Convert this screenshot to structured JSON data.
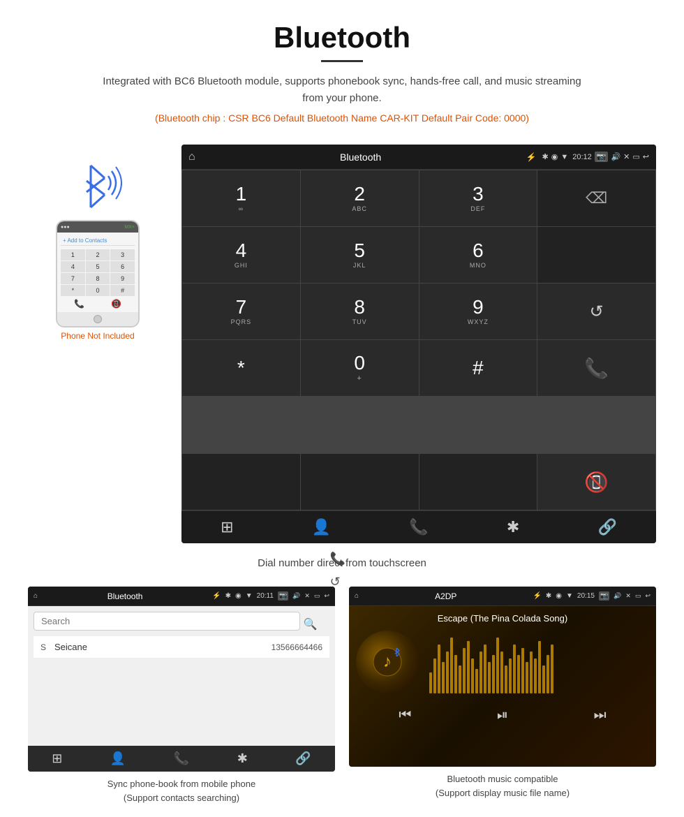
{
  "header": {
    "title": "Bluetooth",
    "underline": true,
    "description": "Integrated with BC6 Bluetooth module, supports phonebook sync, hands-free call, and music streaming from your phone.",
    "specs": "(Bluetooth chip : CSR BC6    Default Bluetooth Name CAR-KIT    Default Pair Code: 0000)"
  },
  "main_screen": {
    "status_bar": {
      "home_icon": "⌂",
      "app_title": "Bluetooth",
      "usb_icon": "⚡",
      "bt_icon": "✱",
      "location_icon": "◉",
      "signal_icon": "▼",
      "time": "20:12",
      "camera_icon": "📷",
      "volume_icon": "🔊",
      "close_icon": "✕",
      "window_icon": "▭",
      "back_icon": "↩"
    },
    "dialpad": {
      "keys": [
        {
          "main": "1",
          "sub": "∞"
        },
        {
          "main": "2",
          "sub": "ABC"
        },
        {
          "main": "3",
          "sub": "DEF"
        },
        {
          "main": "",
          "sub": "",
          "type": "empty"
        },
        {
          "main": "4",
          "sub": "GHI"
        },
        {
          "main": "5",
          "sub": "JKL"
        },
        {
          "main": "6",
          "sub": "MNO"
        },
        {
          "main": "",
          "sub": "",
          "type": "empty"
        },
        {
          "main": "7",
          "sub": "PQRS"
        },
        {
          "main": "8",
          "sub": "TUV"
        },
        {
          "main": "9",
          "sub": "WXYZ"
        },
        {
          "main": "↺",
          "sub": "",
          "type": "action"
        },
        {
          "main": "*",
          "sub": ""
        },
        {
          "main": "0",
          "sub": "+"
        },
        {
          "main": "#",
          "sub": ""
        },
        {
          "main": "📞",
          "sub": "",
          "type": "call"
        },
        {
          "main": "",
          "sub": "",
          "type": "empty-last"
        },
        {
          "main": "",
          "sub": "",
          "type": "empty-last"
        },
        {
          "main": "",
          "sub": "",
          "type": "empty-last"
        },
        {
          "main": "📵",
          "sub": "",
          "type": "end"
        }
      ]
    },
    "bottom_bar": {
      "icons": [
        "⊞",
        "👤",
        "📞",
        "✱",
        "🔗"
      ]
    },
    "caption": "Dial number direct from touchscreen"
  },
  "phonebook_screen": {
    "status_bar": {
      "home": "⌂",
      "title": "Bluetooth",
      "usb": "⚡",
      "time": "20:11",
      "back": "↩"
    },
    "search_placeholder": "Search",
    "contacts": [
      {
        "letter": "S",
        "name": "Seicane",
        "phone": "13566664466"
      }
    ],
    "bottom_icons": [
      "⊞",
      "👤",
      "📞",
      "✱",
      "🔗"
    ],
    "caption_line1": "Sync phone-book from mobile phone",
    "caption_line2": "(Support contacts searching)"
  },
  "music_screen": {
    "status_bar": {
      "home": "⌂",
      "title": "A2DP",
      "usb": "⚡",
      "time": "20:15",
      "back": "↩"
    },
    "song_title": "Escape (The Pina Colada Song)",
    "bt_music_icon": "✱",
    "controls": [
      "⏮",
      "⏯",
      "⏭"
    ],
    "viz_bars": [
      30,
      50,
      70,
      45,
      60,
      80,
      55,
      40,
      65,
      75,
      50,
      35,
      60,
      70,
      45,
      55,
      80,
      60,
      40,
      50,
      70,
      55,
      65,
      45,
      60,
      50,
      75,
      40,
      55,
      70
    ],
    "caption_line1": "Bluetooth music compatible",
    "caption_line2": "(Support display music file name)"
  },
  "phone": {
    "not_included": "Phone Not Included"
  }
}
